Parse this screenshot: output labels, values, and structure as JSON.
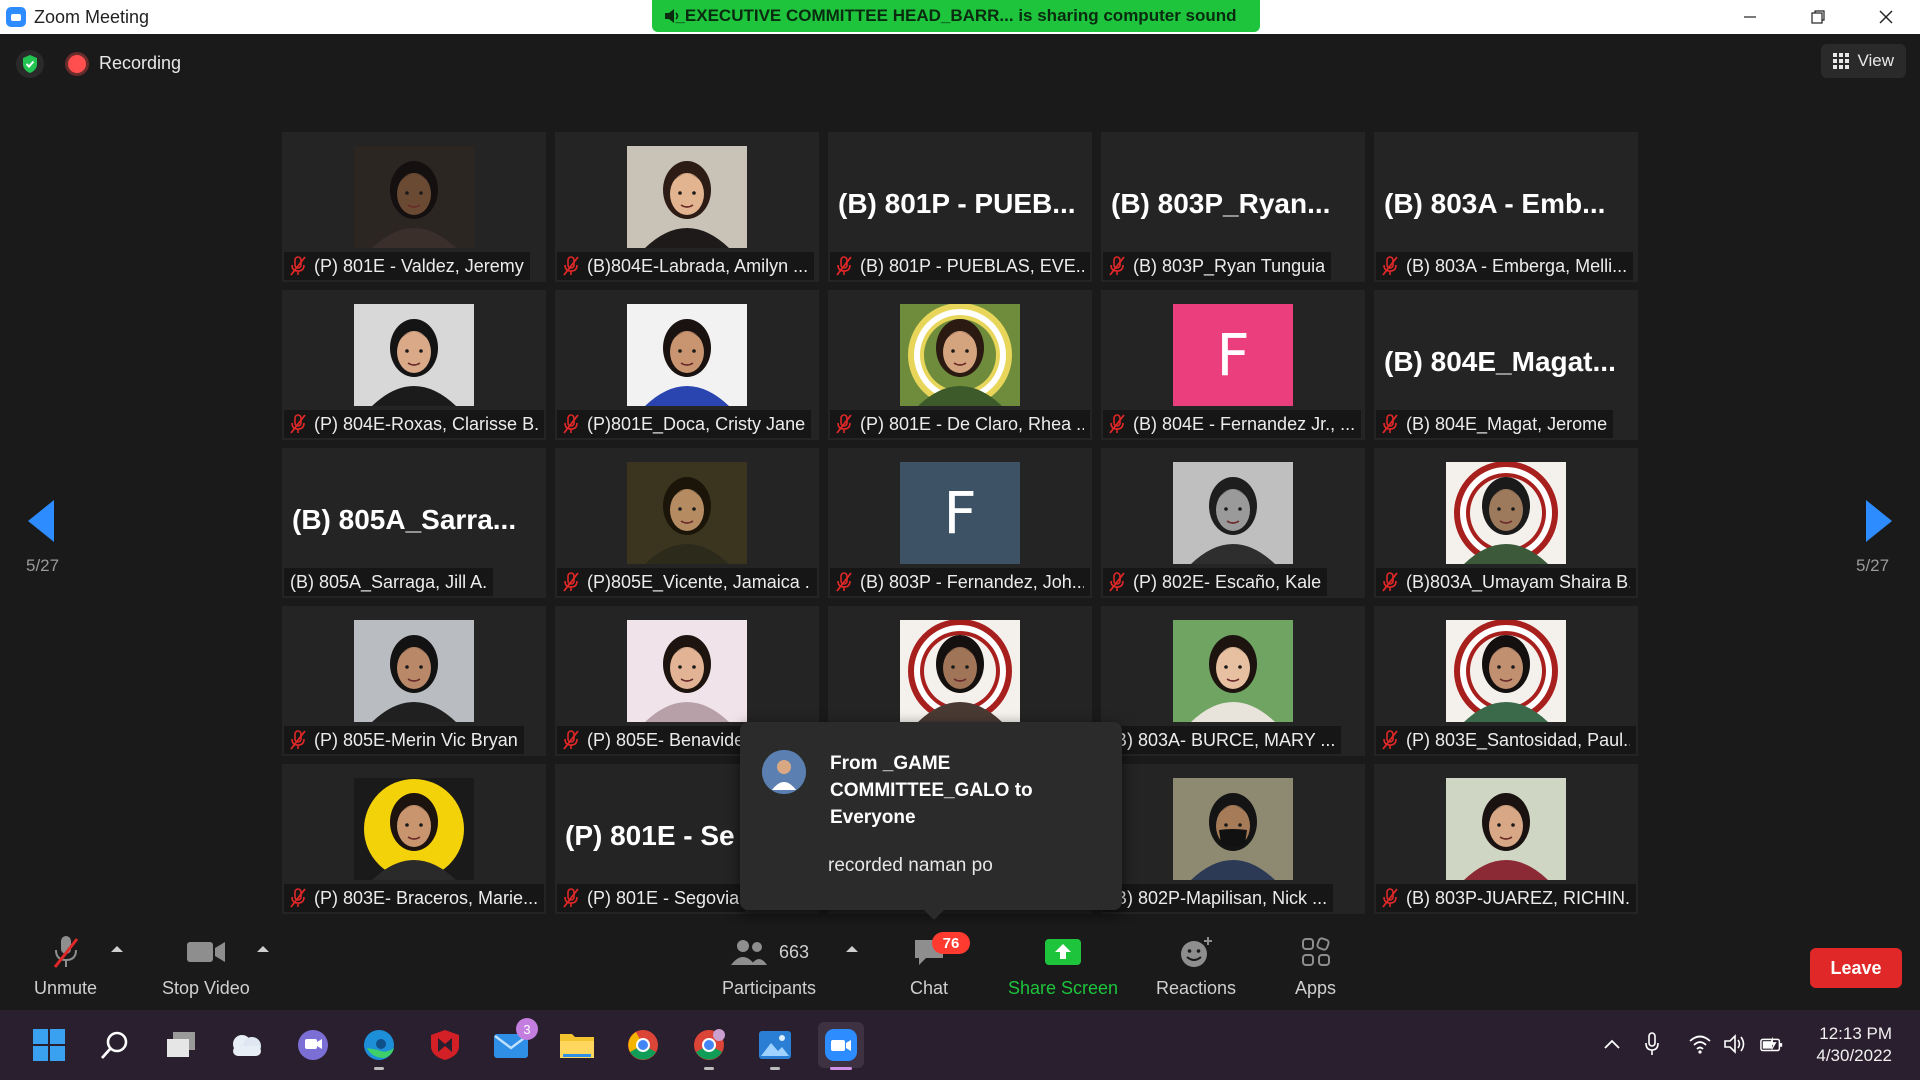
{
  "window": {
    "title": "Zoom Meeting",
    "controls": [
      "minimize",
      "restore",
      "close"
    ]
  },
  "banner": {
    "text": "_EXECUTIVE COMMITTEE HEAD_BARR... is sharing computer sound"
  },
  "status": {
    "recording_label": "Recording",
    "view_label": "View"
  },
  "pagination": {
    "left_page": "5/27",
    "right_page": "5/27"
  },
  "tiles": [
    {
      "name": "(P) 801E - Valdez, Jeremy",
      "big": "",
      "photo": true,
      "bg": "#2b2622",
      "skin": "#6b4a34",
      "hair": "#151010",
      "shirt": "#3a2f2a",
      "muted": true
    },
    {
      "name": "(B)804E-Labrada, Amilyn ...",
      "big": "",
      "photo": true,
      "bg": "#c9c2b6",
      "skin": "#e2b48f",
      "hair": "#2c1c15",
      "shirt": "#1f1a1a",
      "muted": true
    },
    {
      "name": "(B) 801P - PUEBLAS, EVE...",
      "big": "(B) 801P - PUEB...",
      "photo": false,
      "muted": true
    },
    {
      "name": "(B) 803P_Ryan Tunguia",
      "big": "(B) 803P_Ryan...",
      "photo": false,
      "muted": true
    },
    {
      "name": "(B) 803A - Emberga, Melli...",
      "big": "(B) 803A - Emb...",
      "photo": false,
      "muted": true
    },
    {
      "name": "(P) 804E-Roxas, Clarisse B.",
      "big": "",
      "photo": true,
      "bg": "#d8d8d8",
      "skin": "#d9a988",
      "hair": "#141414",
      "shirt": "#1b1b1b",
      "muted": true
    },
    {
      "name": "(P)801E_Doca, Cristy Jane",
      "big": "",
      "photo": true,
      "bg": "#f2f2f2",
      "skin": "#c99470",
      "hair": "#1a1210",
      "shirt": "#2a45b0",
      "muted": true
    },
    {
      "name": "(P) 801E - De Claro, Rhea ...",
      "big": "",
      "photo": true,
      "bg": "#6e8c3c",
      "skin": "#d4a47e",
      "hair": "#2a1a12",
      "shirt": "#3c5a2a",
      "muted": true,
      "frame": "#e8d65a"
    },
    {
      "name": "(B) 804E - Fernandez Jr., ...",
      "big": "",
      "photo": false,
      "letter": "F",
      "letter_bg": "#eb3f7d",
      "muted": true
    },
    {
      "name": "(B) 804E_Magat, Jerome",
      "big": "(B) 804E_Magat...",
      "photo": false,
      "muted": true
    },
    {
      "name": "(B) 805A_Sarraga, Jill A.",
      "big": "(B) 805A_Sarra...",
      "photo": false,
      "muted": false
    },
    {
      "name": "(P)805E_Vicente, Jamaica ...",
      "big": "",
      "photo": true,
      "bg": "#3b3520",
      "skin": "#b58c62",
      "hair": "#1a1508",
      "shirt": "#2c2a1a",
      "muted": true
    },
    {
      "name": "(B) 803P - Fernandez, Joh...",
      "big": "",
      "photo": false,
      "letter": "F",
      "letter_bg": "#3d5264",
      "muted": true
    },
    {
      "name": "(P) 802E- Escaño, Kale",
      "big": "",
      "photo": true,
      "bg": "#bfbfbf",
      "skin": "#9a9a9a",
      "hair": "#1e1e1e",
      "shirt": "#2e2e2e",
      "muted": true
    },
    {
      "name": "(B)803A_Umayam Shaira B.",
      "big": "",
      "photo": true,
      "bg": "#f4f1ec",
      "skin": "#9e7a5c",
      "hair": "#1a1a1a",
      "shirt": "#3c5a3a",
      "muted": true,
      "frame": "#a8201e"
    },
    {
      "name": "(P) 805E-Merin Vic Bryan",
      "big": "",
      "photo": true,
      "bg": "#b9bcc0",
      "skin": "#b88868",
      "hair": "#121212",
      "shirt": "#202020",
      "muted": true
    },
    {
      "name": "(P) 805E- Benavides",
      "big": "",
      "photo": true,
      "bg": "#f0e4ea",
      "skin": "#e2b394",
      "hair": "#1e140f",
      "shirt": "#b8a0a8",
      "muted": true
    },
    {
      "name": "",
      "big": "",
      "photo": true,
      "bg": "#f4f1ec",
      "skin": "#a07456",
      "hair": "#151010",
      "shirt": "#4a3a34",
      "muted": false,
      "frame": "#a8201e"
    },
    {
      "name": "(B) 803A- BURCE, MARY ...",
      "big": "",
      "photo": true,
      "bg": "#6fa462",
      "skin": "#e6c0a0",
      "hair": "#1d1410",
      "shirt": "#e8e4dc",
      "muted": false
    },
    {
      "name": "(P) 803E_Santosidad, Paul...",
      "big": "",
      "photo": true,
      "bg": "#f4f1ec",
      "skin": "#c09070",
      "hair": "#151010",
      "shirt": "#3a6a4a",
      "muted": true,
      "frame": "#a8201e"
    },
    {
      "name": "(P) 803E- Braceros, Marie...",
      "big": "",
      "photo": true,
      "bg": "#1a1a1a",
      "skin": "#c9956e",
      "hair": "#1c130f",
      "shirt": "#2a2a2a",
      "muted": true,
      "circle": "#f3d20a"
    },
    {
      "name": "(P) 801E - Segovia",
      "big": "(P) 801E - Se",
      "photo": false,
      "muted": true
    },
    {
      "name": "",
      "big": "",
      "photo": false,
      "muted": false,
      "empty": true
    },
    {
      "name": "(B) 802P-Mapilisan, Nick ...",
      "big": "",
      "photo": true,
      "bg": "#8e8a72",
      "skin": "#a67c58",
      "hair": "#141414",
      "shirt": "#2c3a56",
      "muted": false,
      "mask": true
    },
    {
      "name": "(B) 803P-JUAREZ, RICHIN...",
      "big": "",
      "photo": true,
      "bg": "#cfd6c4",
      "skin": "#d8a886",
      "hair": "#1a1210",
      "shirt": "#8b2a34",
      "muted": true
    }
  ],
  "chat_popup": {
    "from": "From _GAME COMMITTEE_GALO to Everyone",
    "message": "recorded naman po"
  },
  "toolbar": {
    "unmute_label": "Unmute",
    "stop_video_label": "Stop Video",
    "participants_label": "Participants",
    "participants_count": "663",
    "chat_label": "Chat",
    "chat_badge": "76",
    "share_label": "Share Screen",
    "reactions_label": "Reactions",
    "apps_label": "Apps",
    "leave_label": "Leave",
    "share_color": "#1dc43c",
    "leave_color": "#e02828"
  },
  "taskbar": {
    "mail_badge": "3",
    "time": "12:13 PM",
    "date": "4/30/2022"
  }
}
